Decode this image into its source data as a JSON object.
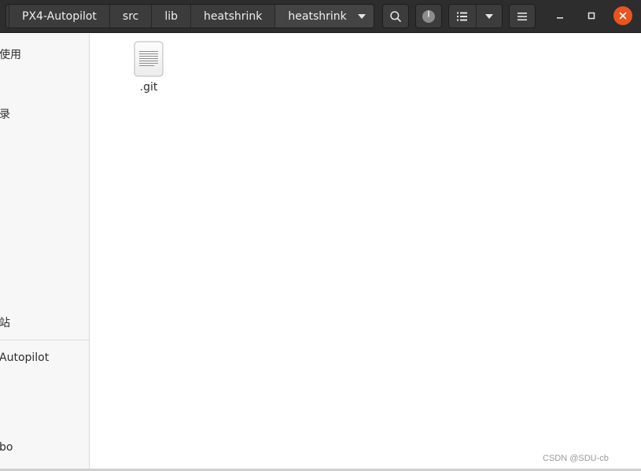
{
  "breadcrumb": {
    "items": [
      {
        "label": "PX4-Autopilot"
      },
      {
        "label": "src"
      },
      {
        "label": "lib"
      },
      {
        "label": "heatshrink"
      },
      {
        "label": "heatshrink"
      }
    ]
  },
  "toolbar": {
    "search_icon": "search-icon",
    "progress_icon": "operations-progress-icon",
    "view_icon": "list-view-icon",
    "menu_icon": "hamburger-menu-icon"
  },
  "window_controls": {
    "minimize_icon": "minimize-icon",
    "maximize_icon": "maximize-icon",
    "close_icon": "close-icon",
    "close_color": "#e95420"
  },
  "sidebar": {
    "items": [
      {
        "label": "使用"
      },
      {
        "label": "录"
      },
      {
        "label": "站"
      },
      {
        "label": "Autopilot"
      },
      {
        "label": "bo"
      }
    ]
  },
  "files": [
    {
      "name": ".git",
      "icon": "text-document-icon"
    }
  ],
  "watermark": "CSDN @SDU-cb"
}
